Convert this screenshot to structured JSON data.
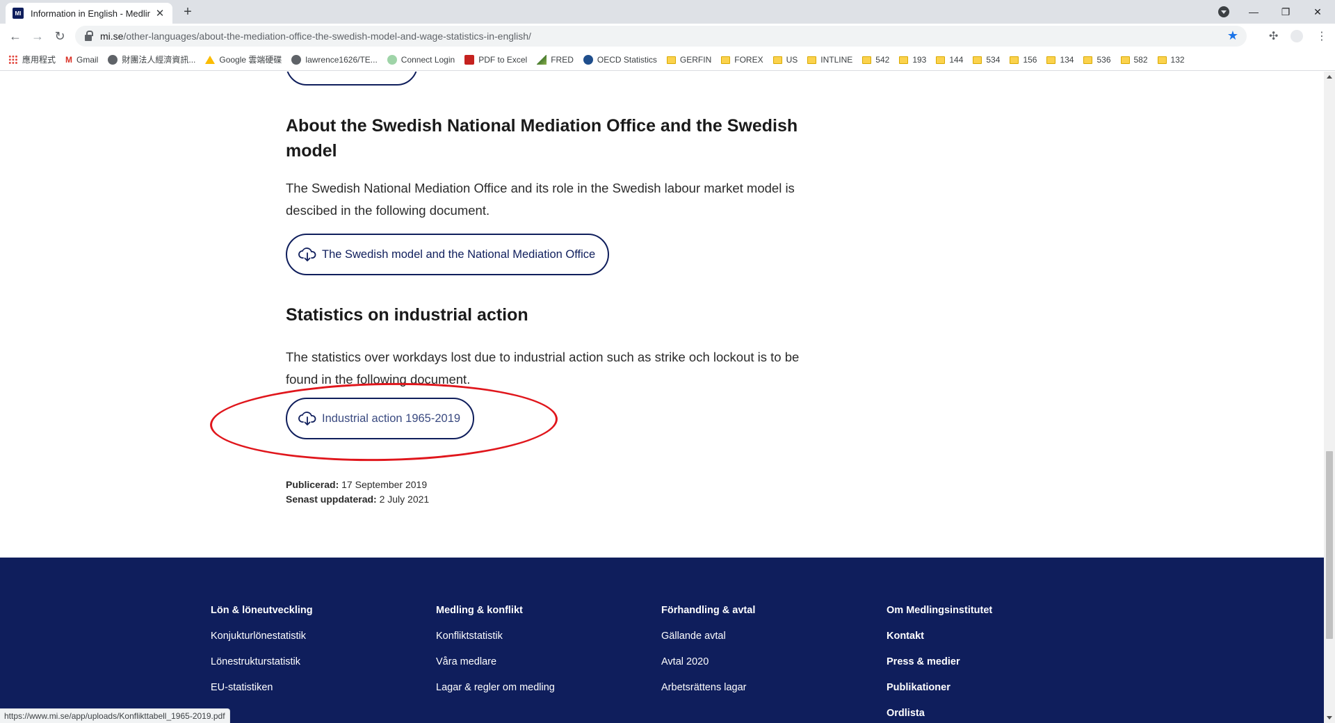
{
  "browser": {
    "tab_title": "Information in English - Medlin",
    "favicon_text": "MI",
    "url_host": "mi.se",
    "url_path": "/other-languages/about-the-mediation-office-the-swedish-model-and-wage-statistics-in-english/",
    "bookmarks": [
      {
        "label": "應用程式",
        "icon": "apps-grid-icon"
      },
      {
        "label": "Gmail",
        "icon": "gmail-icon"
      },
      {
        "label": "財團法人經濟資訊...",
        "icon": "globe-icon"
      },
      {
        "label": "Google 雲端硬碟",
        "icon": "drive-icon"
      },
      {
        "label": "lawrence1626/TE...",
        "icon": "github-icon"
      },
      {
        "label": "Connect Login",
        "icon": "connect-icon"
      },
      {
        "label": "PDF to Excel",
        "icon": "pdf-icon"
      },
      {
        "label": "FRED",
        "icon": "fred-icon"
      },
      {
        "label": "OECD Statistics",
        "icon": "oecd-icon"
      },
      {
        "label": "GERFIN",
        "icon": "folder-icon"
      },
      {
        "label": "FOREX",
        "icon": "folder-icon"
      },
      {
        "label": "US",
        "icon": "folder-icon"
      },
      {
        "label": "INTLINE",
        "icon": "folder-icon"
      },
      {
        "label": "542",
        "icon": "folder-icon"
      },
      {
        "label": "193",
        "icon": "folder-icon"
      },
      {
        "label": "144",
        "icon": "folder-icon"
      },
      {
        "label": "534",
        "icon": "folder-icon"
      },
      {
        "label": "156",
        "icon": "folder-icon"
      },
      {
        "label": "134",
        "icon": "folder-icon"
      },
      {
        "label": "536",
        "icon": "folder-icon"
      },
      {
        "label": "582",
        "icon": "folder-icon"
      },
      {
        "label": "132",
        "icon": "folder-icon"
      }
    ],
    "status_url": "https://www.mi.se/app/uploads/Konflikttabell_1965-2019.pdf"
  },
  "main": {
    "section1": {
      "heading": "About the Swedish National Mediation Office and the Swedish model",
      "text": "The Swedish National Mediation Office and its role in the Swedish labour market model is descibed in the following document.",
      "button": "The Swedish model and the National Mediation Office"
    },
    "section2": {
      "heading": "Statistics on industrial action",
      "text": "The statistics over workdays lost due to industrial action such as strike och lockout is to be found in the following document.",
      "button": "Industrial action 1965-2019"
    },
    "meta": {
      "published_label": "Publicerad:",
      "published_value": "17 September 2019",
      "updated_label": "Senast uppdaterad:",
      "updated_value": "2 July 2021"
    }
  },
  "footer": {
    "columns": [
      {
        "heading": "Lön & löneutveckling",
        "links": [
          "Konjukturlönestatistik",
          "Lönestrukturstatistik",
          "EU-statistiken"
        ]
      },
      {
        "heading": "Medling & konflikt",
        "links": [
          "Konfliktstatistik",
          "Våra medlare",
          "Lagar & regler om medling"
        ]
      },
      {
        "heading": "Förhandling & avtal",
        "links": [
          "Gällande avtal",
          "Avtal 2020",
          "Arbetsrättens lagar"
        ]
      },
      {
        "heading": "Om Medlingsinstitutet",
        "links": [
          "Kontakt",
          "Press & medier",
          "Publikationer",
          "Ordlista"
        ]
      }
    ]
  },
  "colors": {
    "brand_navy": "#0f1e5c",
    "highlight_red": "#e0161c",
    "bookmark_star": "#1a73e8"
  }
}
